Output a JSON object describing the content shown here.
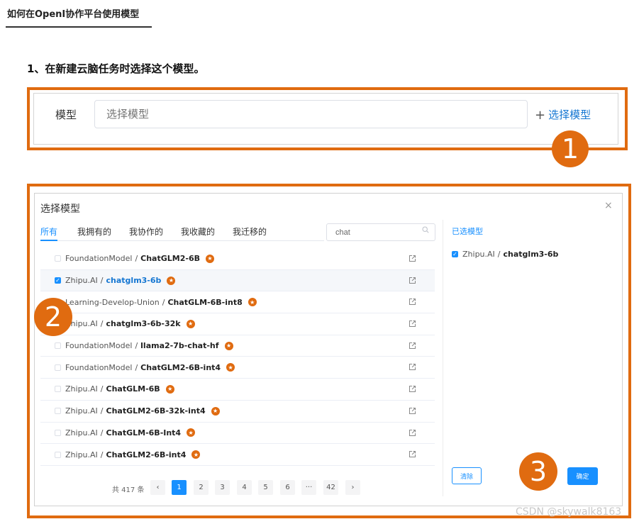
{
  "header": {
    "title": "如何在OpenI协作平台使用模型"
  },
  "step1": {
    "heading": "1、在新建云脑任务时选择这个模型。"
  },
  "form": {
    "label": "模型",
    "input_placeholder": "选择模型",
    "select_link": "选择模型",
    "plus_icon": "+"
  },
  "badges": {
    "one": "1",
    "two": "2",
    "three": "3"
  },
  "dialog": {
    "title": "选择模型",
    "close_icon": "×",
    "tabs": [
      "所有",
      "我拥有的",
      "我协作的",
      "我收藏的",
      "我迁移的"
    ],
    "active_tab": 0,
    "search_value": "chat",
    "rows": [
      {
        "owner": "FoundationModel",
        "name": "ChatGLM2-6B",
        "checked": false
      },
      {
        "owner": "Zhipu.AI",
        "name": "chatglm3-6b",
        "checked": true
      },
      {
        "owner": "Learning-Develop-Union",
        "name": "ChatGLM-6B-int8",
        "checked": false
      },
      {
        "owner": "Zhipu.AI",
        "name": "chatglm3-6b-32k",
        "checked": false
      },
      {
        "owner": "FoundationModel",
        "name": "llama2-7b-chat-hf",
        "checked": false
      },
      {
        "owner": "FoundationModel",
        "name": "ChatGLM2-6B-int4",
        "checked": false
      },
      {
        "owner": "Zhipu.AI",
        "name": "ChatGLM-6B",
        "checked": false
      },
      {
        "owner": "Zhipu.AI",
        "name": "ChatGLM2-6B-32k-int4",
        "checked": false
      },
      {
        "owner": "Zhipu.AI",
        "name": "ChatGLM-6B-Int4",
        "checked": false
      },
      {
        "owner": "Zhipu.AI",
        "name": "ChatGLM2-6B-int4",
        "checked": false
      }
    ],
    "separator": "/",
    "selected_title": "已选模型",
    "selected_items": [
      {
        "owner": "Zhipu.AI",
        "name": "chatglm3-6b"
      }
    ],
    "clear_button": "清除",
    "confirm_button": "确定",
    "pagination": {
      "total_text": "共 417 条",
      "prev": "‹",
      "next": "›",
      "pages": [
        "1",
        "2",
        "3",
        "4",
        "5",
        "6",
        "···",
        "42"
      ],
      "current": "1"
    }
  },
  "watermark": "CSDN @skywalk8163",
  "colors": {
    "highlight": "#e06b10",
    "accent": "#1890ff"
  }
}
